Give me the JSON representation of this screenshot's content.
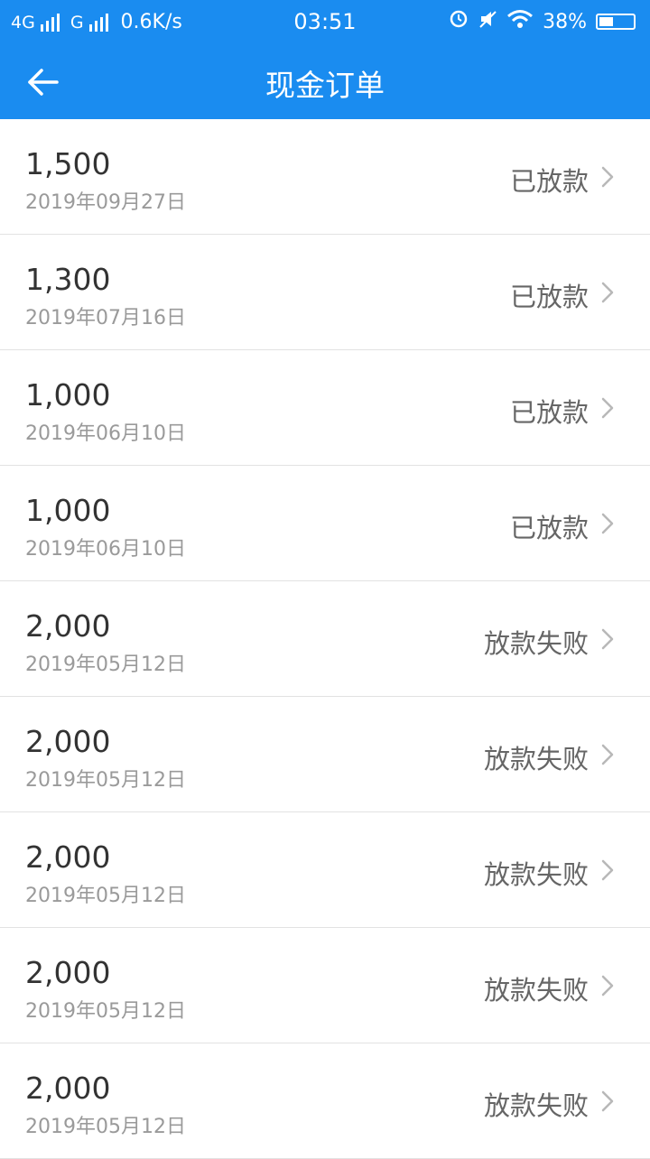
{
  "status_bar": {
    "network": "4G",
    "network2": "G",
    "speed": "0.6K/s",
    "time": "03:51",
    "battery": "38%",
    "icons": [
      "signal-icon",
      "alarm-icon",
      "mute-icon",
      "wifi-icon",
      "battery-icon"
    ]
  },
  "header": {
    "title": "现金订单",
    "back_icon": "arrow-left-icon"
  },
  "colors": {
    "header_bg": "#1a8cf0",
    "amount": "#333333",
    "date": "#9a9a9a",
    "status": "#666666",
    "divider": "#e2e2e2"
  },
  "orders": [
    {
      "amount": "1,500",
      "date": "2019年09月27日",
      "status": "已放款"
    },
    {
      "amount": "1,300",
      "date": "2019年07月16日",
      "status": "已放款"
    },
    {
      "amount": "1,000",
      "date": "2019年06月10日",
      "status": "已放款"
    },
    {
      "amount": "1,000",
      "date": "2019年06月10日",
      "status": "已放款"
    },
    {
      "amount": "2,000",
      "date": "2019年05月12日",
      "status": "放款失败"
    },
    {
      "amount": "2,000",
      "date": "2019年05月12日",
      "status": "放款失败"
    },
    {
      "amount": "2,000",
      "date": "2019年05月12日",
      "status": "放款失败"
    },
    {
      "amount": "2,000",
      "date": "2019年05月12日",
      "status": "放款失败"
    },
    {
      "amount": "2,000",
      "date": "2019年05月12日",
      "status": "放款失败"
    }
  ]
}
